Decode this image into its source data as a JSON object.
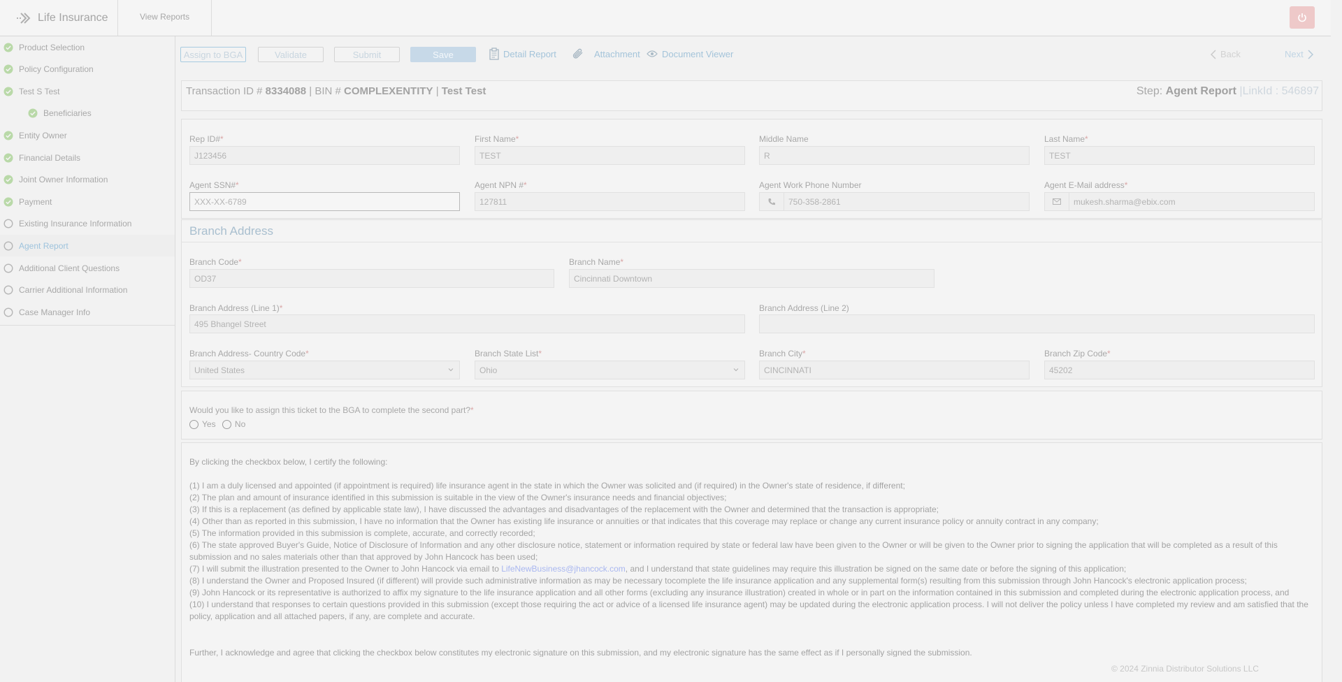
{
  "header": {
    "app_title": "Life Insurance",
    "view_reports": "View Reports"
  },
  "sidebar": {
    "items": [
      {
        "label": "Product Selection",
        "done": true
      },
      {
        "label": "Policy Configuration",
        "done": true
      },
      {
        "label": "Test S Test",
        "done": true
      },
      {
        "label": "Beneficiaries",
        "done": true,
        "indent": true
      },
      {
        "label": "Entity Owner",
        "done": true
      },
      {
        "label": "Financial Details",
        "done": true
      },
      {
        "label": "Joint Owner Information",
        "done": true
      },
      {
        "label": "Payment",
        "done": true
      },
      {
        "label": "Existing Insurance Information",
        "done": false
      },
      {
        "label": "Agent Report",
        "done": false,
        "active": true
      },
      {
        "label": "Additional Client Questions",
        "done": false
      },
      {
        "label": "Carrier Additional Information",
        "done": false
      },
      {
        "label": "Case Manager Info",
        "done": false
      }
    ]
  },
  "toolbar": {
    "assign_bga": "Assign to BGA",
    "validate": "Validate",
    "submit": "Submit",
    "save": "Save",
    "detail_report": "Detail Report",
    "attachment": "Attachment",
    "document_viewer": "Document Viewer",
    "back": "Back",
    "next": "Next"
  },
  "transaction": {
    "tx_label": "Transaction ID #",
    "tx_id": "8334088",
    "bin_label": "| BIN #",
    "bin": "COMPLEXENTITY",
    "sep": "|",
    "name": "Test Test",
    "step_label": "Step:",
    "step_name": "Agent Report",
    "link_label": "|LinkId : 546897"
  },
  "agent": {
    "rep_id_label": "Rep ID#",
    "rep_id": "J123456",
    "first_name_label": "First Name",
    "first_name": "TEST",
    "middle_name_label": "Middle Name",
    "middle_name": "R",
    "last_name_label": "Last Name",
    "last_name": "TEST",
    "ssn_label": "Agent SSN#",
    "ssn_placeholder": "XXX-XX-6789",
    "npn_label": "Agent NPN #",
    "npn": "127811",
    "phone_label": "Agent Work Phone Number",
    "phone": "750-358-2861",
    "email_label": "Agent E-Mail address",
    "email": "mukesh.sharma@ebix.com"
  },
  "branch": {
    "title": "Branch Address",
    "code_label": "Branch Code",
    "code": "OD37",
    "name_label": "Branch Name",
    "name": "Cincinnati Downtown",
    "addr1_label": "Branch Address (Line 1)",
    "addr1": "495 Bhangel Street",
    "addr2_label": "Branch Address (Line 2)",
    "addr2": "",
    "country_label": "Branch Address- Country Code",
    "country": "United States",
    "state_label": "Branch State List",
    "state": "Ohio",
    "city_label": "Branch City",
    "city": "CINCINNATI",
    "zip_label": "Branch Zip Code",
    "zip": "45202"
  },
  "bga_question": {
    "question": "Would you like to assign this ticket to the BGA to complete the second part?",
    "yes": "Yes",
    "no": "No"
  },
  "certification": {
    "intro": "By clicking the checkbox below, I certify the following:",
    "items": [
      "(1) I am a duly licensed and appointed (if appointment is required) life insurance agent in the state in which the Owner was solicited and (if required) in the Owner's state of residence, if different;",
      "(2) The plan and amount of insurance identified in this submission is suitable in the view of the Owner's insurance needs and financial objectives;",
      "(3) If this is a replacement (as defined by applicable state law), I have discussed the advantages and disadvantages of the replacement with the Owner and determined that the transaction is appropriate;",
      "(4) Other than as reported in this submission, I have no information that the Owner has existing life insurance or annuities or that indicates that this coverage may replace or change any current insurance policy or annuity contract in any company;",
      "(5) The information provided in this submission is complete, accurate, and correctly recorded;",
      "(6) The state approved Buyer's Guide, Notice of Disclosure of Information and any other disclosure notice, statement or information required by state or federal law have been given to the Owner or will be given to the Owner prior to signing the application that will be completed as a result of this submission and no sales materials other than that approved by John Hancock has been used;"
    ],
    "item7_pre": "(7) I will submit the illustration presented to the Owner to John Hancock via email to ",
    "item7_email": "LifeNewBusiness@jhancock.com",
    "item7_post": ", and I understand that state guidelines may require this illustration be signed on the same date or before the signing of this application;",
    "items_after": [
      "(8) I understand the Owner and Proposed Insured (if different) will provide such administrative information as may be necessary tocomplete the life insurance application and any supplemental form(s) resulting from this submission through John Hancock's electronic application process;",
      "(9) John Hancock or its representative is authorized to affix my signature to the life insurance application and all other forms (excluding any insurance illustration) created in whole or in part on the information contained in this submission and completed during the electronic application process, and",
      "(10) I understand that responses to certain questions provided in this submission (except those requiring the act or advice of a licensed life insurance agent) may be updated during the electronic application process. I will not deliver the policy unless I have completed my review and am satisfied that the policy, application and all attached papers, if any, are complete and accurate."
    ],
    "further": "Further, I acknowledge and agree that clicking the checkbox below constitutes my electronic signature on this submission, and my electronic signature has the same effect as if I personally signed the submission."
  },
  "footer": {
    "copyright": "© 2024 Zinnia Distributor Solutions LLC"
  }
}
